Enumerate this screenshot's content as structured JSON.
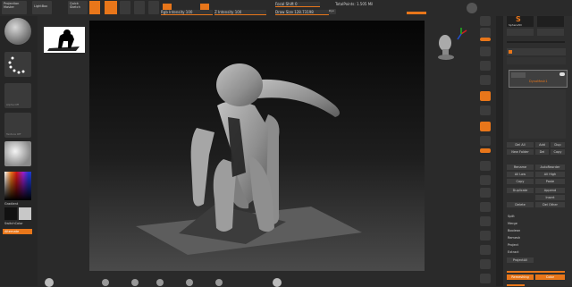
{
  "topbar": {
    "projection_master": "Projection Master",
    "lightbox": "LightBox",
    "quick_sketch": "Quick Sketch",
    "rgb_intensity": "Rgb Intensity 100",
    "z_intensity": "Z Intensity 100",
    "draw_size": "Draw Size 128.73198",
    "focal_shift": "Focal Shift 0",
    "dyn": "Dyn",
    "total_points": "TotalPoints: 1.505 Mil"
  },
  "leftshelf": {
    "alpha_off": "Alpha Off",
    "texture_off": "Texture Off",
    "gradient": "Gradient",
    "switch_color": "SwitchColor",
    "alternate": "Alternate"
  },
  "rightpanel": {
    "thumb_label": "Sphere3D",
    "active_label": "DynaMesh1",
    "rows": [
      [
        "Del All",
        "Add",
        "Dup"
      ],
      [
        "New Folder",
        "Del",
        "Copy"
      ],
      [
        "Rename",
        "AutoReorder"
      ],
      [
        "All Low",
        "All High"
      ],
      [
        "Copy",
        "Paste"
      ],
      [
        "Duplicate",
        "Append"
      ],
      [
        "Insert"
      ],
      [
        "Delete",
        "Del Other"
      ],
      [
        "Split"
      ],
      [
        "Merge"
      ],
      [
        "Boolean"
      ],
      [
        "Remesh"
      ],
      [
        "Project"
      ],
      [
        "Extract"
      ]
    ],
    "project_all": "ProjectAll",
    "remesh_btn": "Remeshing",
    "color": "Color"
  },
  "colors": {
    "accent": "#e8761a",
    "background": "#2b2b2b",
    "model": "#9a9a9a"
  }
}
